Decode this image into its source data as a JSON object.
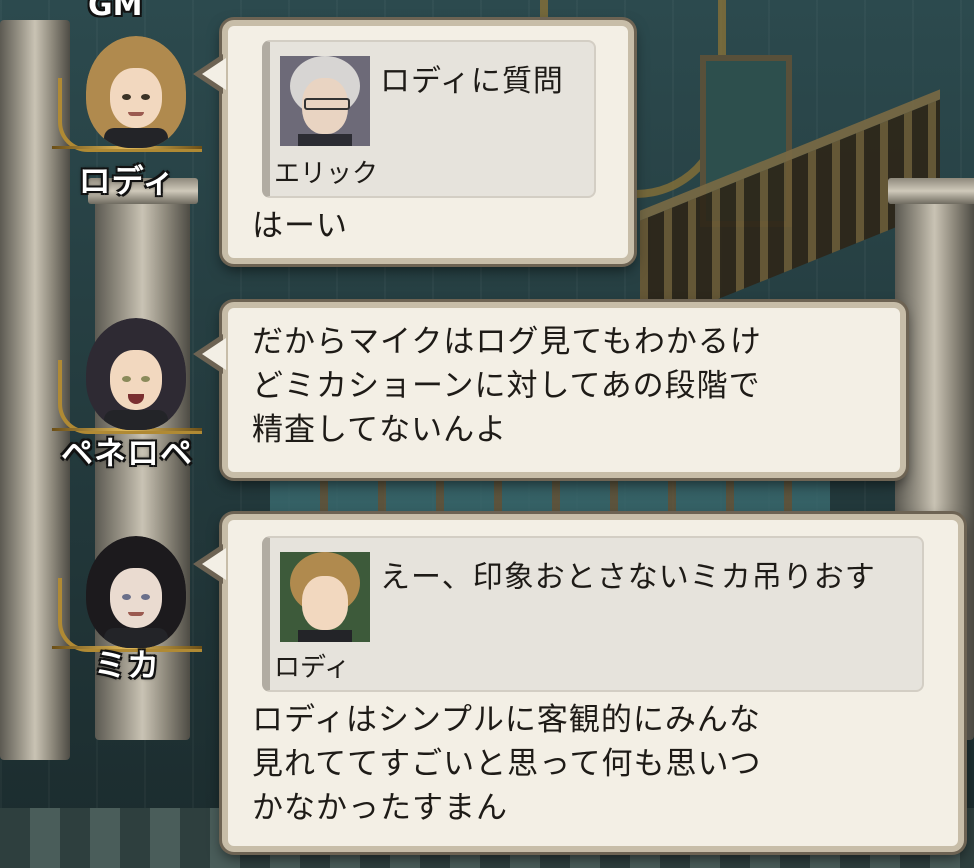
{
  "header": {
    "gm_label": "GM"
  },
  "speakers": [
    {
      "name": "ロディ",
      "avatar_icon": "rody-portrait-icon",
      "hair_color": "#b08a4e"
    },
    {
      "name": "ペネロペ",
      "avatar_icon": "penelope-portrait-icon",
      "hair_color": "#2e2a33"
    },
    {
      "name": "ミカ",
      "avatar_icon": "mika-portrait-icon",
      "hair_color": "#1c1a1d"
    }
  ],
  "messages": [
    {
      "speaker": "ロディ",
      "quote": {
        "author": "エリック",
        "text": "ロディに質問",
        "avatar_icon": "eric-portrait-icon"
      },
      "text": "はーい"
    },
    {
      "speaker": "ペネロペ",
      "text": "だからマイクはログ見てもわかるけ\nどミカショーンに対してあの段階で\n精査してないんよ"
    },
    {
      "speaker": "ミカ",
      "quote": {
        "author": "ロディ",
        "text": "えー、印象おとさないミカ吊りおす",
        "avatar_icon": "rody-portrait-icon"
      },
      "text": "ロディはシンプルに客観的にみんな\n見れててすごいと思って何も思いつ\nかなかったすまん"
    }
  ],
  "colors": {
    "bubble_bg": "#f3efe5",
    "bubble_border": "#c7bda8",
    "gold": "#b08a34"
  }
}
